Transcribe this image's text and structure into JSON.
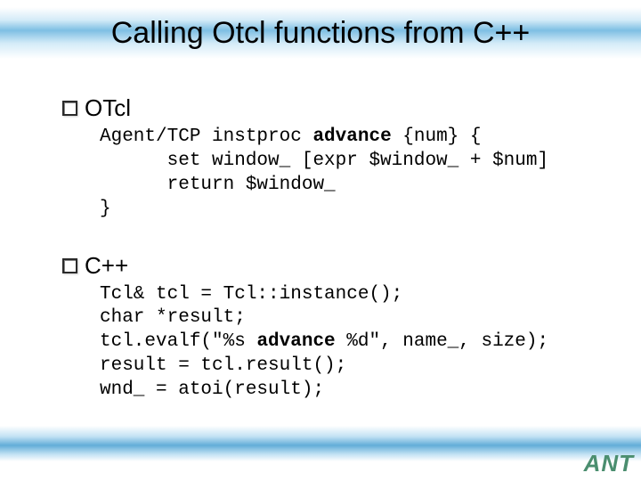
{
  "title": "Calling Otcl functions from C++",
  "sections": {
    "otcl": {
      "label": "OTcl",
      "code_lines": [
        "Agent/TCP instproc ",
        "advance",
        " {num} {",
        "      set window_ [expr $window_ + $num]",
        "      return $window_",
        "}"
      ]
    },
    "cpp": {
      "label": "C++",
      "code_lines": [
        "Tcl& tcl = Tcl::instance();",
        "char *result;",
        "tcl.evalf(\"%s ",
        "advance",
        " %d\", name_, size);",
        "result = tcl.result();",
        "wnd_ = atoi(result);"
      ]
    }
  },
  "logo": "ANT"
}
